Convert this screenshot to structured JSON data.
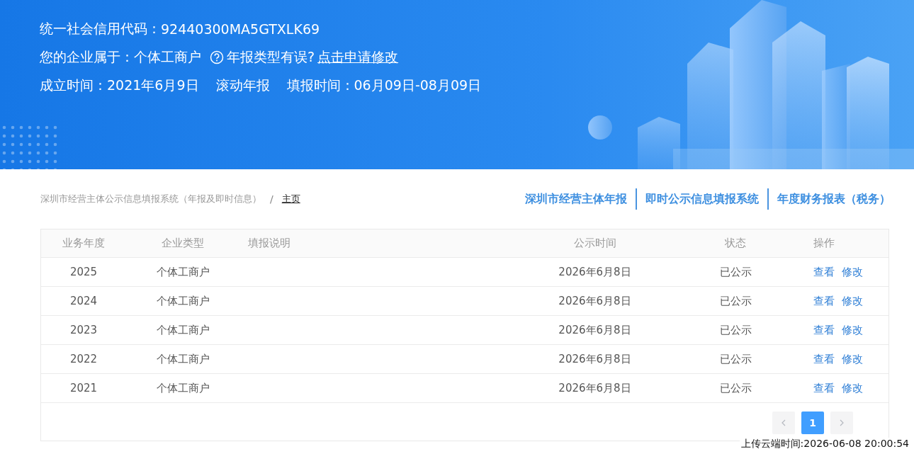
{
  "banner": {
    "lines": [
      {
        "kind": "code",
        "label": "统一社会信用代码：",
        "value": "92440300MA5GTXLK69"
      },
      {
        "kind": "type",
        "label": "您的企业属于：",
        "value": "个体工商户",
        "hint": "年报类型有误?",
        "link": "点击申请修改"
      },
      {
        "kind": "dates",
        "items": [
          "成立时间：2021年6月9日",
          "滚动年报",
          "填报时间：06月09日-08月09日"
        ]
      }
    ]
  },
  "breadcrumb": {
    "separator": "/",
    "items": [
      "深圳市经营主体公示信息填报系统（年报及即时信息）",
      "主页"
    ]
  },
  "nav_links": [
    "深圳市经营主体年报",
    "即时公示信息填报系统",
    "年度财务报表（税务）"
  ],
  "table": {
    "columns": [
      "业务年度",
      "企业类型",
      "填报说明",
      "公示时间",
      "状态",
      "操作"
    ],
    "rows": [
      {
        "year": "2025",
        "type": "个体工商户",
        "time": "2026年6月8日",
        "status": "已公示",
        "actions": [
          "查看",
          "修改"
        ]
      },
      {
        "year": "2024",
        "type": "个体工商户",
        "time": "2026年6月8日",
        "status": "已公示",
        "actions": [
          "查看",
          "修改"
        ]
      },
      {
        "year": "2023",
        "type": "个体工商户",
        "time": "2026年6月8日",
        "status": "已公示",
        "actions": [
          "查看",
          "修改"
        ]
      },
      {
        "year": "2022",
        "type": "个体工商户",
        "time": "2026年6月8日",
        "status": "已公示",
        "actions": [
          "查看",
          "修改"
        ]
      },
      {
        "year": "2021",
        "type": "个体工商户",
        "time": "2026年6月8日",
        "status": "已公示",
        "actions": [
          "查看",
          "修改"
        ]
      }
    ]
  },
  "pagination": {
    "pages": [
      {
        "label": "1",
        "selected": true
      }
    ]
  },
  "upload_time": "上传云端时间:2026-06-08 20:00:54"
}
